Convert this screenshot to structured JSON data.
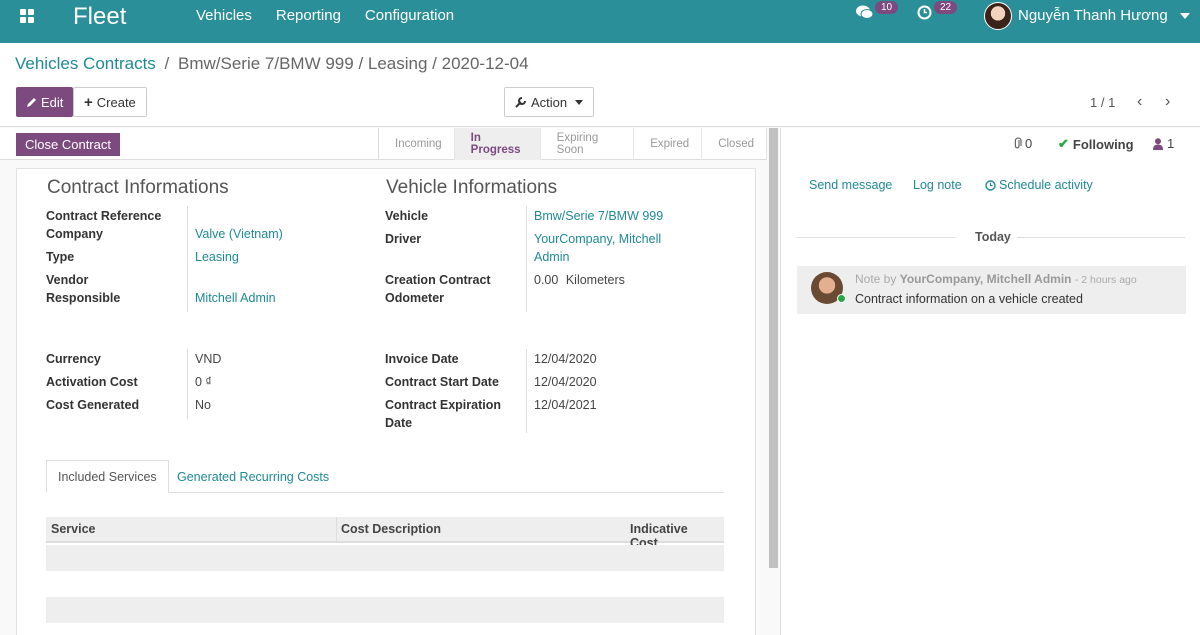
{
  "navbar": {
    "brand": "Fleet",
    "menu": [
      "Vehicles",
      "Reporting",
      "Configuration"
    ],
    "messages_count": "10",
    "activities_count": "22",
    "user_name": "Nguyễn Thanh Hương"
  },
  "control": {
    "breadcrumb_root": "Vehicles Contracts",
    "breadcrumb_sep": "/",
    "breadcrumb_current": "Bmw/Serie 7/BMW 999 / Leasing / 2020-12-04",
    "edit_label": "Edit",
    "create_label": "Create",
    "action_label": "Action",
    "pager": "1 / 1"
  },
  "statusbar": {
    "close_contract": "Close Contract",
    "stages": [
      "Incoming",
      "In Progress",
      "Expiring Soon",
      "Expired",
      "Closed"
    ],
    "active_stage": "In Progress"
  },
  "form": {
    "contract_title": "Contract Informations",
    "vehicle_title": "Vehicle Informations",
    "left_fields": [
      {
        "label": "Contract Reference",
        "value": ""
      },
      {
        "label": "Company",
        "value": "Valve (Vietnam)"
      },
      {
        "label": "Type",
        "value": "Leasing"
      },
      {
        "label": "Vendor",
        "value": ""
      },
      {
        "label": "Responsible",
        "value": "Mitchell Admin"
      }
    ],
    "right_fields": [
      {
        "label": "Vehicle",
        "value": "Bmw/Serie 7/BMW 999"
      },
      {
        "label": "Driver",
        "value": "YourCompany, Mitchell Admin"
      },
      {
        "label": "Creation Contract Odometer",
        "value": "0.00",
        "unit": "Kilometers"
      }
    ],
    "cost_fields": [
      {
        "label": "Currency",
        "value": "VND"
      },
      {
        "label": "Activation Cost",
        "value": "0 ₫"
      },
      {
        "label": "Cost Generated",
        "value": "No"
      }
    ],
    "date_fields": [
      {
        "label": "Invoice Date",
        "value": "12/04/2020"
      },
      {
        "label": "Contract Start Date",
        "value": "12/04/2020"
      },
      {
        "label": "Contract Expiration Date",
        "value": "12/04/2021"
      }
    ],
    "tabs": [
      "Included Services",
      "Generated Recurring Costs"
    ],
    "table_headers": [
      "Service",
      "Cost Description",
      "Indicative Cost..."
    ]
  },
  "chatter": {
    "attachments": "0",
    "following": "Following",
    "followers": "1",
    "send_message": "Send message",
    "log_note": "Log note",
    "schedule_activity": "Schedule activity",
    "day": "Today",
    "message": {
      "prefix": "Note by",
      "author": "YourCompany, Mitchell Admin",
      "time": "- 2 hours ago",
      "body": "Contract information on a vehicle created"
    }
  },
  "colors": {
    "navbar": "#2a8f98",
    "primary": "#7c4a7f",
    "link": "#1f8a96"
  }
}
